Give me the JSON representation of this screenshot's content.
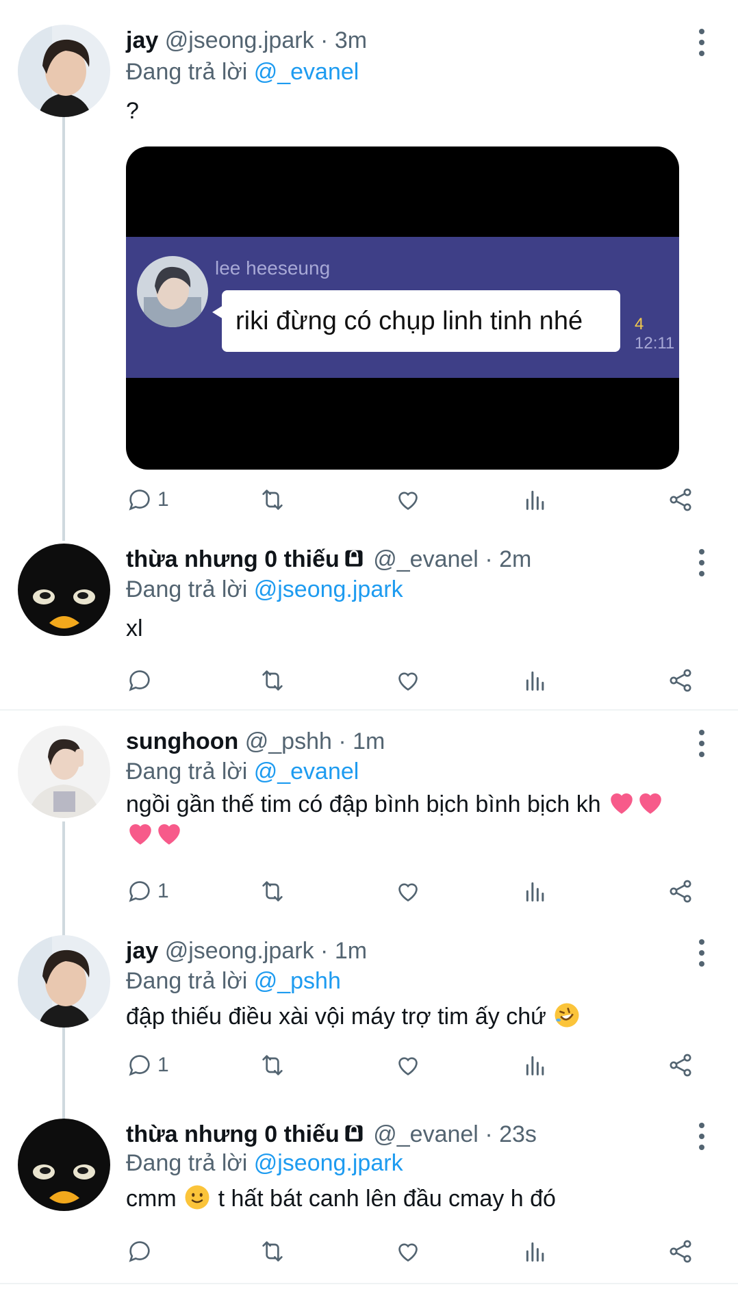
{
  "tweets": [
    {
      "name": "jay",
      "handle": "@jseong.jpark",
      "dot": "·",
      "time": "3m",
      "reply_prefix": "Đang trả lời",
      "reply_to": "@_evanel",
      "text": "?",
      "counts": {
        "reply": "1",
        "retweet": "",
        "like": ""
      },
      "locked": false
    },
    {
      "name": "thừa nhưng 0 thiếu",
      "handle": "@_evanel",
      "dot": "·",
      "time": "2m",
      "reply_prefix": "Đang trả lời",
      "reply_to": "@jseong.jpark",
      "text": "xl",
      "counts": {
        "reply": "",
        "retweet": "",
        "like": ""
      },
      "locked": true
    },
    {
      "name": "sunghoon",
      "handle": "@_pshh",
      "dot": "·",
      "time": "1m",
      "reply_prefix": "Đang trả lời",
      "reply_to": "@_evanel",
      "text_line1": "ngồi gần thế tim có đập bình bịch bình bịch kh",
      "counts": {
        "reply": "1",
        "retweet": "",
        "like": ""
      },
      "locked": false
    },
    {
      "name": "jay",
      "handle": "@jseong.jpark",
      "dot": "·",
      "time": "1m",
      "reply_prefix": "Đang trả lời",
      "reply_to": "@_pshh",
      "text": "đập thiếu điều xài vội máy trợ tim ấy chứ",
      "counts": {
        "reply": "1",
        "retweet": "",
        "like": ""
      },
      "locked": false
    },
    {
      "name": "thừa nhưng 0 thiếu",
      "handle": "@_evanel",
      "dot": "·",
      "time": "23s",
      "reply_prefix": "Đang trả lời",
      "reply_to": "@jseong.jpark",
      "text_before": "cmm",
      "text_after": "t hất bát canh lên đầu cmay h đó",
      "counts": {
        "reply": "",
        "retweet": "",
        "like": ""
      },
      "locked": true
    }
  ],
  "media": {
    "chat_name": "lee heeseung",
    "chat_message": "riki đừng có chụp linh tinh nhé",
    "chat_count": "4",
    "chat_time": "12:11"
  },
  "colors": {
    "text": "#0f1419",
    "secondary": "#536471",
    "link": "#1d9bf0",
    "thread_line": "#cfd9de",
    "chat_band": "#3e3f87"
  },
  "icons": [
    "reply-icon",
    "retweet-icon",
    "like-icon",
    "stats-icon",
    "share-icon",
    "more-icon",
    "lock-icon"
  ]
}
